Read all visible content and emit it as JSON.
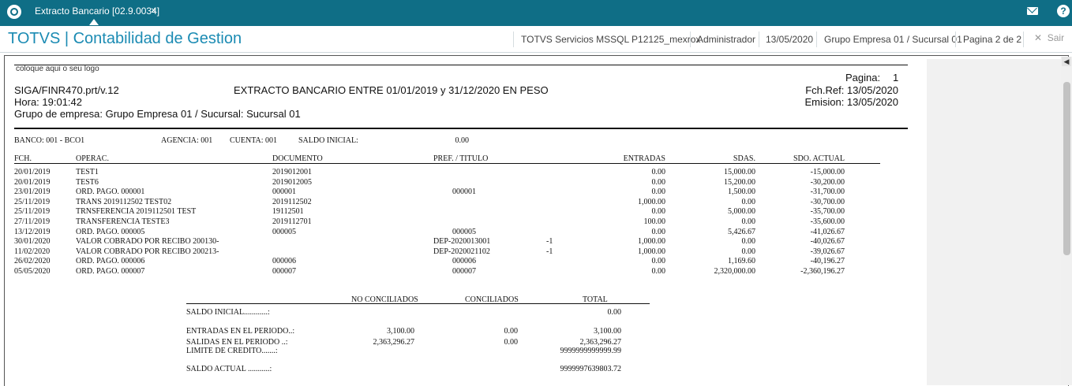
{
  "topbar": {
    "tab_title": "Extracto Bancario [02.9.0034]",
    "close_glyph": "×",
    "icons": [
      "logo-icon",
      "mail-icon",
      "help-icon"
    ]
  },
  "header": {
    "app_title": "TOTVS | Contabilidad de Gestion",
    "server": "TOTVS Servicios MSSQL P12125_mexrox",
    "user": "Administrador",
    "date": "13/05/2020",
    "company": "Grupo Empresa 01 / Sucursal 01",
    "page": "Pagina 2 de 2",
    "exit_label": "Sair"
  },
  "report": {
    "logo_text": "coloque aqui o seu logo",
    "pagina_label": "Pagina:",
    "pagina_value": "1",
    "program": "SIGA/FINR470.prt/v.12",
    "title": "EXTRACTO BANCARIO ENTRE 01/01/2019 y 31/12/2020  EN PESO",
    "fchref": "Fch.Ref: 13/05/2020",
    "hora": "Hora: 19:01:42",
    "emision": "Emision: 13/05/2020",
    "grupo": "Grupo de empresa: Grupo Empresa 01 / Sucursal: Sucursal 01",
    "banco": "BANCO: 001 - BCO1",
    "agencia": "AGENCIA: 001",
    "cuenta": "CUENTA: 001",
    "saldo_inicial_label": "SALDO INICIAL:",
    "saldo_inicial_value": "0.00",
    "columns": {
      "fch": "FCH.",
      "operac": "OPERAC.",
      "documento": "DOCUMENTO",
      "pref": "PREF. / TITULO",
      "entradas": "ENTRADAS",
      "sdas": "SDAS.",
      "sdo": "SDO. ACTUAL"
    },
    "rows": [
      {
        "fch": "20/01/2019",
        "op": "TEST1",
        "doc": "2019012001",
        "pref": "",
        "sign": "",
        "ent": "0.00",
        "sdas": "15,000.00",
        "sdo": "-15,000.00"
      },
      {
        "fch": "20/01/2019",
        "op": "TEST6",
        "doc": "2019012005",
        "pref": "",
        "sign": "",
        "ent": "0.00",
        "sdas": "15,200.00",
        "sdo": "-30,200.00"
      },
      {
        "fch": "23/01/2019",
        "op": "ORD. PAGO. 000001",
        "doc": "000001",
        "pref": "000001",
        "sign": "",
        "ent": "0.00",
        "sdas": "1,500.00",
        "sdo": "-31,700.00"
      },
      {
        "fch": "25/11/2019",
        "op": "TRANS 2019112502 TEST02",
        "doc": "2019112502",
        "pref": "",
        "sign": "",
        "ent": "1,000.00",
        "sdas": "0.00",
        "sdo": "-30,700.00"
      },
      {
        "fch": "25/11/2019",
        "op": "TRNSFERENCIA 2019112501 TEST",
        "doc": "19112501",
        "pref": "",
        "sign": "",
        "ent": "0.00",
        "sdas": "5,000.00",
        "sdo": "-35,700.00"
      },
      {
        "fch": "27/11/2019",
        "op": "TRANSFERENCIA TESTE3",
        "doc": "2019112701",
        "pref": "",
        "sign": "",
        "ent": "100.00",
        "sdas": "0.00",
        "sdo": "-35,600.00"
      },
      {
        "fch": "13/12/2019",
        "op": "ORD. PAGO. 000005",
        "doc": "000005",
        "pref": "000005",
        "sign": "",
        "ent": "0.00",
        "sdas": "5,426.67",
        "sdo": "-41,026.67"
      },
      {
        "fch": "30/01/2020",
        "op": "VALOR COBRADO POR RECIBO 200130-",
        "doc": "",
        "pref": "DEP-2020013001",
        "sign": "-1",
        "ent": "1,000.00",
        "sdas": "0.00",
        "sdo": "-40,026.67"
      },
      {
        "fch": "11/02/2020",
        "op": "VALOR COBRADO POR RECIBO 200213-",
        "doc": "",
        "pref": "DEP-2020021102",
        "sign": "-1",
        "ent": "1,000.00",
        "sdas": "0.00",
        "sdo": "-39,026.67"
      },
      {
        "fch": "26/02/2020",
        "op": "ORD. PAGO. 000006",
        "doc": "000006",
        "pref": "000006",
        "sign": "",
        "ent": "0.00",
        "sdas": "1,169.60",
        "sdo": "-40,196.27"
      },
      {
        "fch": "05/05/2020",
        "op": "ORD. PAGO. 000007",
        "doc": "000007",
        "pref": "000007",
        "sign": "",
        "ent": "0.00",
        "sdas": "2,320,000.00",
        "sdo": "-2,360,196.27"
      }
    ],
    "summary": {
      "headers": {
        "no_conc": "NO  CONCILIADOS",
        "conc": "CONCILIADOS",
        "total": "TOTAL"
      },
      "saldo_inicial": {
        "label": "SALDO INICIAL............:",
        "total": "0.00"
      },
      "entradas": {
        "label": "ENTRADAS EN EL PERIODO..:",
        "no_conc": "3,100.00",
        "conc": "0.00",
        "total": "3,100.00"
      },
      "salidas": {
        "label": "SALIDAS EN EL PERIODO ..:",
        "no_conc": "2,363,296.27",
        "conc": "0.00",
        "total": "2,363,296.27"
      },
      "limite": {
        "label": "LIMITE DE CREDITO.......:",
        "total": "9999999999999.99"
      },
      "saldo_actual": {
        "label": "SALDO ACTUAL ...........:",
        "total": "9999997639803.72"
      }
    }
  }
}
